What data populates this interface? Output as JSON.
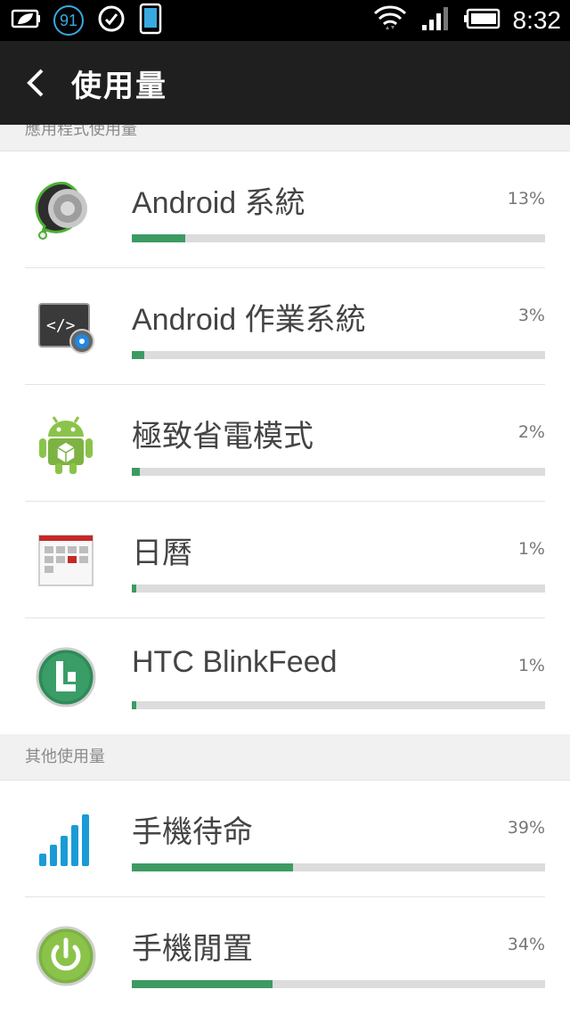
{
  "status_bar": {
    "notification_count": "91",
    "time": "8:32",
    "icons": [
      "leaf-battery-icon",
      "sync-icon",
      "phone-icon",
      "wifi-icon",
      "signal-icon",
      "battery-icon"
    ]
  },
  "action_bar": {
    "title": "使用量"
  },
  "sections": {
    "apps_header": "應用程式使用量",
    "other_header": "其他使用量"
  },
  "apps": [
    {
      "name": "Android 系統",
      "percent": "13%",
      "value": 13
    },
    {
      "name": "Android 作業系統",
      "percent": "3%",
      "value": 3
    },
    {
      "name": "極致省電模式",
      "percent": "2%",
      "value": 2
    },
    {
      "name": "日曆",
      "percent": "1%",
      "value": 1
    },
    {
      "name": "HTC BlinkFeed",
      "percent": "1%",
      "value": 1
    }
  ],
  "other": [
    {
      "name": "手機待命",
      "percent": "39%",
      "value": 39
    },
    {
      "name": "手機閒置",
      "percent": "34%",
      "value": 34
    }
  ],
  "colors": {
    "bar_fill": "#3d9a63",
    "bar_track": "#dcdcdc",
    "action_bar": "#1f1f1f"
  }
}
